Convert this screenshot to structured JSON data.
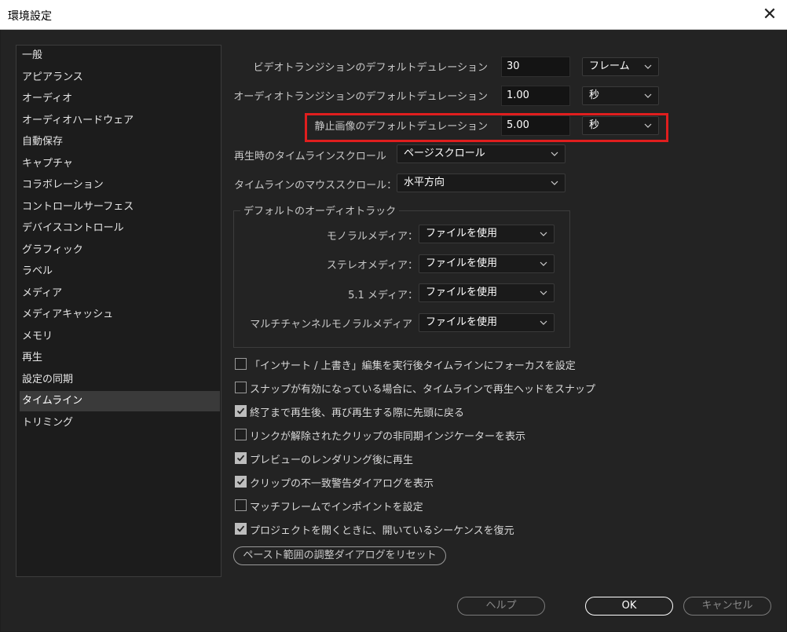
{
  "window": {
    "title": "環境設定",
    "close_glyph": "✕"
  },
  "sidebar": {
    "items": [
      {
        "label": "一般"
      },
      {
        "label": "アピアランス"
      },
      {
        "label": "オーディオ"
      },
      {
        "label": "オーディオハードウェア"
      },
      {
        "label": "自動保存"
      },
      {
        "label": "キャプチャ"
      },
      {
        "label": "コラボレーション"
      },
      {
        "label": "コントロールサーフェス"
      },
      {
        "label": "デバイスコントロール"
      },
      {
        "label": "グラフィック"
      },
      {
        "label": "ラベル"
      },
      {
        "label": "メディア"
      },
      {
        "label": "メディアキャッシュ"
      },
      {
        "label": "メモリ"
      },
      {
        "label": "再生"
      },
      {
        "label": "設定の同期"
      },
      {
        "label": "タイムライン",
        "selected": true
      },
      {
        "label": "トリミング"
      }
    ]
  },
  "settings": {
    "video_transition": {
      "label": "ビデオトランジションのデフォルトデュレーション",
      "value": "30",
      "unit": "フレーム"
    },
    "audio_transition": {
      "label": "オーディオトランジションのデフォルトデュレーション",
      "value": "1.00",
      "unit": "秒"
    },
    "still_image": {
      "label": "静止画像のデフォルトデュレーション",
      "value": "5.00",
      "unit": "秒"
    },
    "playback_scroll": {
      "label": "再生時のタイムラインスクロール",
      "value": "ページスクロール"
    },
    "mouse_scroll": {
      "label": "タイムラインのマウススクロール：",
      "value": "水平方向"
    }
  },
  "audio_tracks": {
    "title": "デフォルトのオーディオトラック",
    "mono": {
      "label": "モノラルメディア：",
      "value": "ファイルを使用"
    },
    "stereo": {
      "label": "ステレオメディア：",
      "value": "ファイルを使用"
    },
    "surround": {
      "label": "5.1 メディア：",
      "value": "ファイルを使用"
    },
    "multi_mono": {
      "label": "マルチチャンネルモノラルメディア",
      "value": "ファイルを使用"
    }
  },
  "checkboxes": [
    {
      "label": "「インサート / 上書き」編集を実行後タイムラインにフォーカスを設定",
      "checked": false
    },
    {
      "label": "スナップが有効になっている場合に、タイムラインで再生ヘッドをスナップ",
      "checked": false
    },
    {
      "label": "終了まで再生後、再び再生する際に先頭に戻る",
      "checked": true
    },
    {
      "label": "リンクが解除されたクリップの非同期インジケーターを表示",
      "checked": false
    },
    {
      "label": "プレビューのレンダリング後に再生",
      "checked": true
    },
    {
      "label": "クリップの不一致警告ダイアログを表示",
      "checked": true
    },
    {
      "label": "マッチフレームでインポイントを設定",
      "checked": false
    },
    {
      "label": "プロジェクトを開くときに、開いているシーケンスを復元",
      "checked": true
    }
  ],
  "buttons": {
    "reset_paste": "ペースト範囲の調整ダイアログをリセット",
    "help": "ヘルプ",
    "ok": "OK",
    "cancel": "キャンセル"
  },
  "colors": {
    "highlight": "#e01e1e",
    "selected_item": "#3a3a3a"
  }
}
